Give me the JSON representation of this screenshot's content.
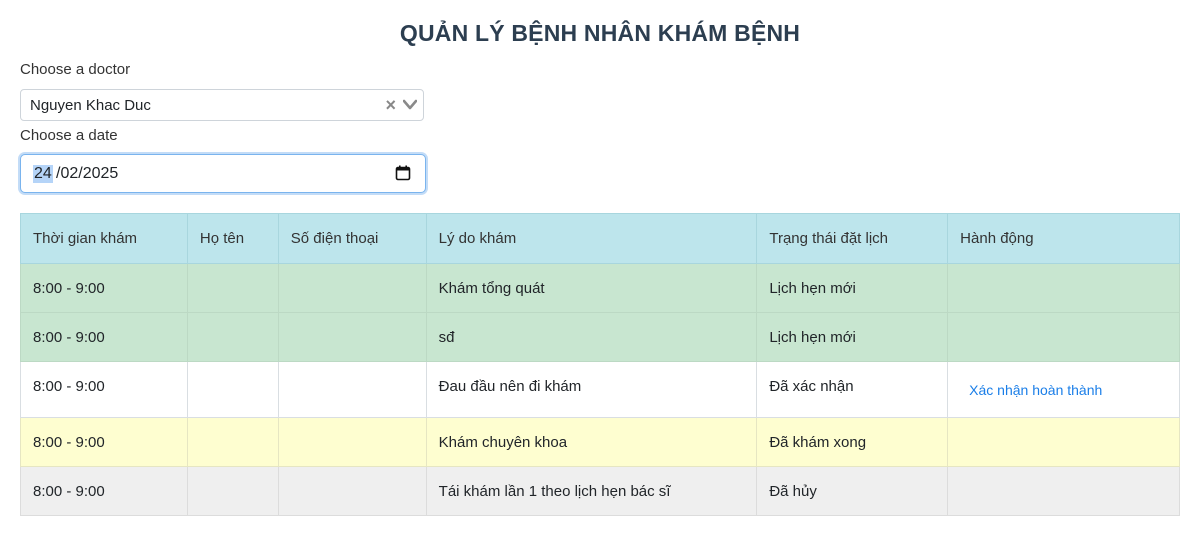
{
  "page": {
    "title": "QUẢN LÝ BỆNH NHÂN KHÁM BỆNH"
  },
  "filters": {
    "doctor_label": "Choose a doctor",
    "doctor_value": "Nguyen Khac Duc",
    "clear_symbol": "×",
    "date_label": "Choose a date",
    "date_day": "24",
    "date_rest": "/02/2025"
  },
  "table": {
    "headers": [
      "Thời gian khám",
      "Họ tên",
      "Số điện thoại",
      "Lý do khám",
      "Trạng thái đặt lịch",
      "Hành động"
    ],
    "rows": [
      {
        "time": "8:00 - 9:00",
        "name": "",
        "phone": "",
        "reason": "Khám tổng quát",
        "status": "Lịch hẹn mới",
        "action": ""
      },
      {
        "time": "8:00 - 9:00",
        "name": "",
        "phone": "",
        "reason": "sđ",
        "status": "Lịch hẹn mới",
        "action": ""
      },
      {
        "time": "8:00 - 9:00",
        "name": "",
        "phone": "",
        "reason": "Đau đầu nên đi khám",
        "status": "Đã xác nhận",
        "action": "Xác nhận hoàn thành"
      },
      {
        "time": "8:00 - 9:00",
        "name": "",
        "phone": "",
        "reason": "Khám chuyên khoa",
        "status": "Đã khám xong",
        "action": ""
      },
      {
        "time": "8:00 - 9:00",
        "name": "",
        "phone": "",
        "reason": "Tái khám lần 1 theo lịch hẹn bác sĩ",
        "status": "Đã hủy",
        "action": ""
      }
    ]
  },
  "colors": {
    "header_bg": "#bde5ec",
    "new_row": "#c8e6d0",
    "confirmed_row": "#ffffff",
    "done_row": "#fefed0",
    "cancel_row": "#efefef",
    "link": "#1a7ee8"
  },
  "icons": {
    "select_chevron": "chevron-down-icon",
    "select_clear": "close-icon",
    "date_picker": "calendar-icon"
  }
}
